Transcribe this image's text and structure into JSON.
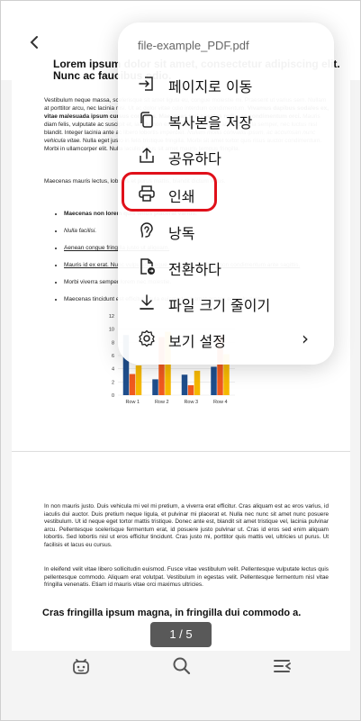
{
  "document": {
    "page1": {
      "title": "Lorem ipsum dolor sit amet, consectetur adipiscing elit. Nunc ac faucibus odio.",
      "para1_a": "Vestibulum neque massa, scelerisque sit amet ligula eu, congue molestie mi. Praesent ut varius sem. Nullam at porttitor arcu, nec lacinia nisi. Ut ac dolor vitae odio interdum condimentum. ",
      "para1_b": "Vivamus dapibus sodales ex, vitae malesuada ipsum cursus convallis. Maecenas sed egestas nulla, ac condimentum orci.",
      "para1_c": " Mauris diam felis, vulputate ac suscipit et, iaculis non est. Curabitur semper arcu ac ligula semper, nec luctus nisl blandit. Integer lacinia ante ac libero lobortis imperdiet. ",
      "para1_d": "Nullam mollis convallis ipsum, ac accumsan nunc vehicula vitae.",
      "para1_e": " Nulla eget justo in felis tristique fringilla. Morbi sit amet tortor quis risus auctor condimentum. Morbi in ullamcorper elit. Nulla iaculis tellus sit amet mauris tempus fringilla.",
      "para2": "Maecenas mauris lectus, lobortis et purus mattis, blandit dictum tellus.",
      "list": [
        "Maecenas non lorem quis tellus placerat varius.",
        "Nulla facilisi.",
        "Aenean congue fringilla justo ut aliquam.",
        "Mauris id ex erat. Nunc vulputate neque vitae justo facilisis, non condimentum ante sagittis.",
        "Morbi viverra semper lorem nec molestie.",
        "Maecenas tincidunt est efficitur ligula euismod, sit amet ornare est vulputate."
      ]
    },
    "page2": {
      "para1": "In non mauris justo. Duis vehicula mi vel mi pretium, a viverra erat efficitur. Cras aliquam est ac eros varius, id iaculis dui auctor. Duis pretium neque ligula, et pulvinar mi placerat et. Nulla nec nunc sit amet nunc posuere vestibulum. Ut id neque eget tortor mattis tristique. Donec ante est, blandit sit amet tristique vel, lacinia pulvinar arcu. Pellentesque scelerisque fermentum erat, id posuere justo pulvinar ut. Cras id eros sed enim aliquam lobortis. Sed lobortis nisl ut eros efficitur tincidunt. Cras justo mi, porttitor quis mattis vel, ultricies ut purus. Ut facilisis et lacus eu cursus.",
      "para2": "In eleifend velit vitae libero sollicitudin euismod. Fusce vitae vestibulum velit. Pellentesque vulputate lectus quis pellentesque commodo. Aliquam erat volutpat. Vestibulum in egestas velit. Pellentesque fermentum nisl vitae fringilla venenatis. Etiam id mauris vitae orci maximus ultricies.",
      "heading": "Cras fringilla ipsum magna, in fringilla dui commodo a."
    }
  },
  "chart_data": {
    "type": "bar",
    "categories": [
      "Row 1",
      "Row 2",
      "Row 3",
      "Row 4"
    ],
    "series": [
      {
        "values": [
          9.1,
          2.4,
          3.1,
          4.3
        ],
        "color": "#1f4e8c"
      },
      {
        "values": [
          3.2,
          8.8,
          1.5,
          9.0
        ],
        "color": "#f05a1e"
      },
      {
        "values": [
          4.5,
          9.6,
          3.7,
          6.2
        ],
        "color": "#f5b800"
      }
    ],
    "ylim": [
      0,
      12
    ],
    "yticks": [
      "0",
      "2",
      "4",
      "6",
      "8",
      "10",
      "12"
    ]
  },
  "page_indicator": "1 / 5",
  "menu": {
    "file_name": "file-example_PDF.pdf",
    "items": [
      {
        "label": "페이지로 이동",
        "icon": "goto-page-icon"
      },
      {
        "label": "복사본을 저장",
        "icon": "copy-icon"
      },
      {
        "label": "공유하다",
        "icon": "share-icon"
      },
      {
        "label": "인쇄",
        "icon": "print-icon"
      },
      {
        "label": "낭독",
        "icon": "read-aloud-icon"
      },
      {
        "label": "전환하다",
        "icon": "convert-icon"
      },
      {
        "label": "파일 크기 줄이기",
        "icon": "compress-icon"
      },
      {
        "label": "보기 설정",
        "icon": "view-settings-icon"
      }
    ],
    "highlight_color": "#e0101a"
  },
  "bottom_bar": {
    "icons": [
      "ai-assistant-icon",
      "search-icon",
      "outline-icon"
    ]
  }
}
